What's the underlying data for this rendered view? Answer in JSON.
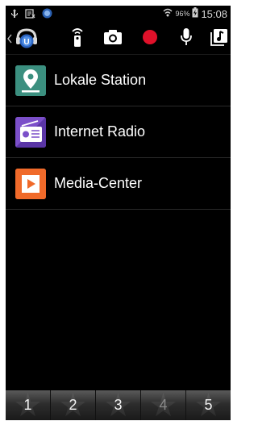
{
  "status": {
    "battery_pct": "96%",
    "clock": "15:08"
  },
  "toolbar": {
    "back_icon": "chevron-left-icon",
    "app_icon": "app-logo-icon",
    "remote_icon": "remote-icon",
    "camera_icon": "camera-icon",
    "record_icon": "record-icon",
    "mic_icon": "microphone-icon",
    "music_icon": "music-library-icon",
    "record_color": "#e0112a"
  },
  "menu": {
    "items": [
      {
        "label": "Lokale Station",
        "icon": "location-pin-icon",
        "color": "#3b8f7f"
      },
      {
        "label": "Internet Radio",
        "icon": "radio-icon",
        "color": "#7b4fc9"
      },
      {
        "label": "Media-Center",
        "icon": "play-icon",
        "color": "#f06a2a"
      }
    ]
  },
  "presets": {
    "items": [
      {
        "label": "1"
      },
      {
        "label": "2"
      },
      {
        "label": "3"
      },
      {
        "label": "4"
      },
      {
        "label": "5"
      }
    ]
  }
}
